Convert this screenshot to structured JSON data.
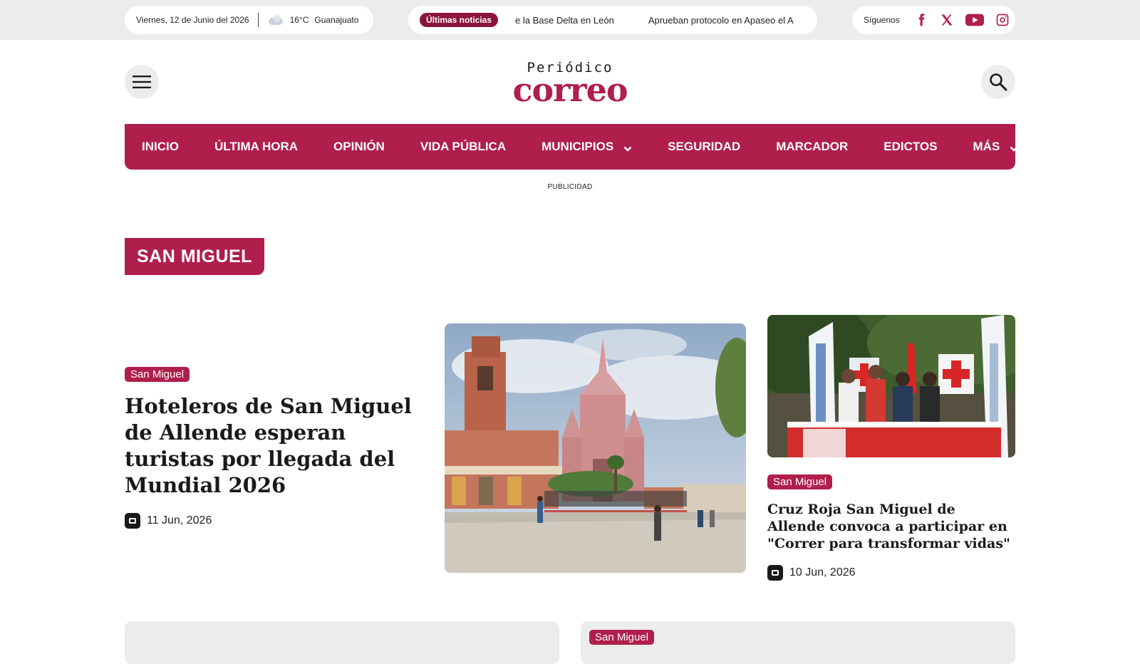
{
  "topbar": {
    "date": "Viernes, 12 de Junio del 2026",
    "weather_icon": "cloud-icon",
    "temperature": "16°C",
    "city": "Guanajuato",
    "news_badge": "Últimas noticias",
    "ticker": [
      "e la Base Delta en León",
      "Aprueban protocolo en Apaseo el A"
    ],
    "follow_label": "Síguenos",
    "social": [
      "facebook-icon",
      "x-icon",
      "youtube-icon",
      "instagram-icon"
    ]
  },
  "header": {
    "logo_small": "Periódico",
    "logo_big": "correo",
    "menu_icon": "hamburger-menu-icon",
    "search_icon": "search-icon"
  },
  "nav": {
    "items": [
      {
        "label": "INICIO"
      },
      {
        "label": "ÚLTIMA HORA"
      },
      {
        "label": "OPINIÓN"
      },
      {
        "label": "VIDA PÚBLICA"
      },
      {
        "label": "MUNICIPIOS"
      },
      {
        "label": "SEGURIDAD"
      },
      {
        "label": "MARCADOR"
      },
      {
        "label": "EDICTOS"
      },
      {
        "label": "MÁS"
      }
    ]
  },
  "ad_label": "PUBLICIDAD",
  "section_title": "SAN MIGUEL",
  "articles": [
    {
      "tag": "San Miguel",
      "headline": "Hoteleros de San Miguel de Allende esperan turistas por llegada del Mundial 2026",
      "date": "11 Jun, 2026"
    },
    {
      "tag": "San Miguel",
      "headline": "Cruz Roja San Miguel de Allende convoca a participar en \"Correr para transformar vidas\"",
      "date": "10 Jun, 2026"
    },
    {
      "tag": "San Miguel"
    }
  ],
  "colors": {
    "brand": "#b01e4b",
    "badge_dark": "#8b1538",
    "topbar_bg": "#ececec"
  }
}
